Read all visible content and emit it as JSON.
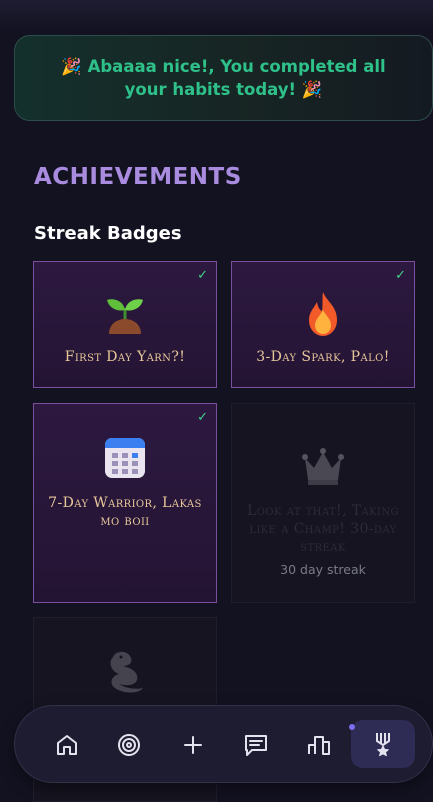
{
  "banner": {
    "text": "🎉 Abaaaa nice!, You completed all your habits today! 🎉"
  },
  "achievements": {
    "title": "ACHIEVEMENTS",
    "streak_section": "Streak Badges",
    "badges": [
      {
        "name": "First Day Yarn?!",
        "icon": "seedling-icon",
        "unlocked": true,
        "check": "✓",
        "desc": ""
      },
      {
        "name": "3-Day Spark, Palo!",
        "icon": "fire-icon",
        "unlocked": true,
        "check": "✓",
        "desc": ""
      },
      {
        "name": "7-Day Warrior, Lakas mo boii",
        "icon": "calendar-icon",
        "unlocked": true,
        "check": "✓",
        "desc": ""
      },
      {
        "name": "Look at that!, Taking like a Champ! 30-day streak",
        "icon": "crown-icon",
        "unlocked": false,
        "desc": "30 day streak"
      },
      {
        "name": "",
        "icon": "dragon-icon",
        "unlocked": false,
        "desc": ""
      }
    ]
  },
  "nav": {
    "items": [
      {
        "icon": "home-icon"
      },
      {
        "icon": "target-icon"
      },
      {
        "icon": "plus-icon"
      },
      {
        "icon": "message-icon"
      },
      {
        "icon": "leaderboard-icon"
      },
      {
        "icon": "medal-icon",
        "active": true
      }
    ]
  },
  "colors": {
    "banner_text": "#2ec18a",
    "title": "#a98cdf",
    "badge_name": "#e8c99a",
    "check": "#3fd48a",
    "nav_active": "#2e2c55"
  }
}
